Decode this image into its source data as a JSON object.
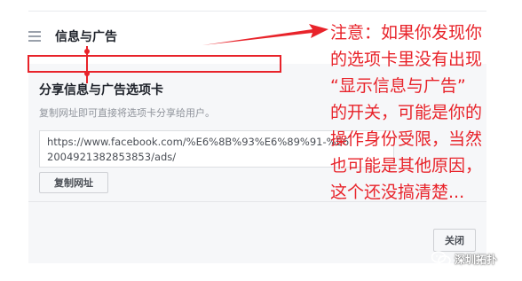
{
  "header": {
    "title": "信息与广告"
  },
  "panel": {
    "title": "分享信息与广告选项卡",
    "description": "复制网址即可直接将选项卡分享给用户。",
    "url": "https://www.facebook.com/%E6%8B%93%E6%89%91-%E6...2004921382853853/ads/",
    "url_line1": "https://www.facebook.com/%E6%8B%93%E6%89%91-%E6",
    "url_line2": "2004921382853853/ads/",
    "copy_label": "复制网址",
    "close_label": "关闭"
  },
  "annotation": {
    "lines": [
      "注意：如果你发现你",
      "的选项卡里没有出现",
      "“显示信息与广告”",
      "的开关，可能是你的",
      "操作身份受限，当然",
      "也可能是其他原因，",
      "这个还没搞清楚..."
    ],
    "color": "#e8232a"
  },
  "watermark": {
    "text": "深圳拓扑"
  },
  "colors": {
    "accent": "#e8232a",
    "panel_bg": "#f6f7f9",
    "text": "#1d2129"
  }
}
